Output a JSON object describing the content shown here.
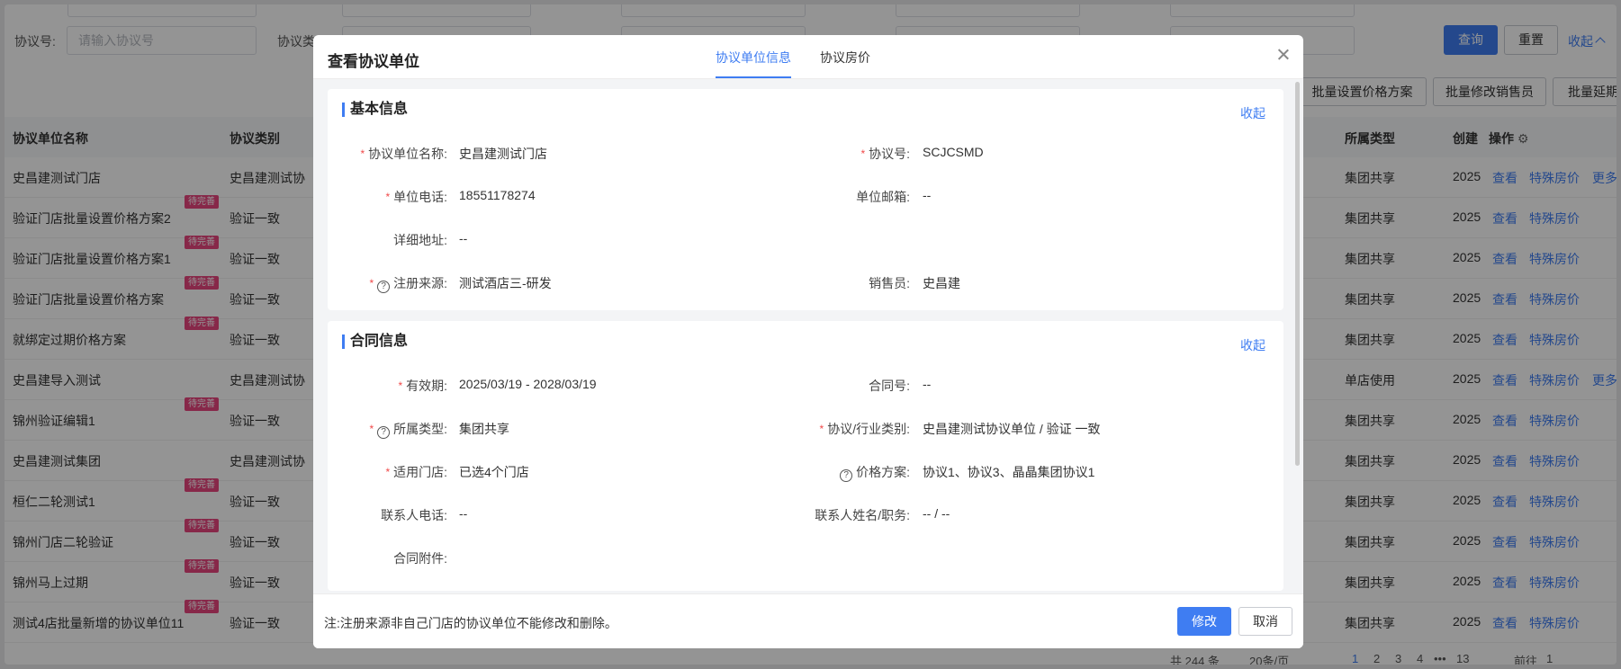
{
  "filters": {
    "agreement_no_label": "协议号:",
    "agreement_no_placeholder": "请输入协议号",
    "category_label": "协议类",
    "query_label": "查询",
    "reset_label": "重置",
    "collapse_label": "收起"
  },
  "batch_actions": [
    "批量设置价格方案",
    "批量修改销售员",
    "批量延期"
  ],
  "table": {
    "headers": {
      "name": "协议单位名称",
      "category": "协议类别",
      "type": "所属类型",
      "created": "创建",
      "actions": "操作"
    },
    "pending_tag": "待完善",
    "ops": {
      "view": "查看",
      "special": "特殊房价",
      "more": "更多"
    },
    "rows": [
      {
        "name": "史昌建测试门店",
        "category": "史昌建测试协",
        "type": "集团共享",
        "created": "2025",
        "tag": false,
        "more": true
      },
      {
        "name": "验证门店批量设置价格方案2",
        "category": "验证一致",
        "type": "集团共享",
        "created": "2025",
        "tag": true,
        "more": false
      },
      {
        "name": "验证门店批量设置价格方案1",
        "category": "验证一致",
        "type": "集团共享",
        "created": "2025",
        "tag": true,
        "more": false
      },
      {
        "name": "验证门店批量设置价格方案",
        "category": "验证一致",
        "type": "集团共享",
        "created": "2025",
        "tag": true,
        "more": false
      },
      {
        "name": "就绑定过期价格方案",
        "category": "验证一致",
        "type": "集团共享",
        "created": "2025",
        "tag": true,
        "more": false
      },
      {
        "name": "史昌建导入测试",
        "category": "史昌建测试协",
        "type": "单店使用",
        "created": "2025",
        "tag": false,
        "more": true
      },
      {
        "name": "锦州验证编辑1",
        "category": "验证一致",
        "type": "集团共享",
        "created": "2025",
        "tag": true,
        "more": false
      },
      {
        "name": "史昌建测试集团",
        "category": "史昌建测试协",
        "type": "集团共享",
        "created": "2025",
        "tag": false,
        "more": false
      },
      {
        "name": "桓仁二轮测试1",
        "category": "验证一致",
        "type": "集团共享",
        "created": "2025",
        "tag": true,
        "more": false
      },
      {
        "name": "锦州门店二轮验证",
        "category": "验证一致",
        "type": "集团共享",
        "created": "2025",
        "tag": true,
        "more": false
      },
      {
        "name": "锦州马上过期",
        "category": "验证一致",
        "type": "集团共享",
        "created": "2025",
        "tag": true,
        "more": false
      },
      {
        "name": "测试4店批量新增的协议单位11",
        "category": "验证一致",
        "type": "集团共享",
        "created": "2025",
        "tag": true,
        "more": false
      }
    ]
  },
  "pagination": {
    "total": "共 244 条",
    "page_size": "20条/页",
    "pages": [
      "1",
      "2",
      "3",
      "4",
      "•••",
      "13"
    ],
    "goto_label": "前往",
    "goto_value": "1"
  },
  "modal": {
    "title": "查看协议单位",
    "tabs": [
      "协议单位信息",
      "协议房价"
    ],
    "basic": {
      "title": "基本信息",
      "collapse": "收起",
      "name_label": "协议单位名称:",
      "name_value": "史昌建测试门店",
      "no_label": "协议号:",
      "no_value": "SCJCSMD",
      "phone_label": "单位电话:",
      "phone_value": "18551178274",
      "email_label": "单位邮箱:",
      "email_value": "--",
      "address_label": "详细地址:",
      "address_value": "--",
      "source_label": "注册来源:",
      "source_value": "测试酒店三-研发",
      "sales_label": "销售员:",
      "sales_value": "史昌建"
    },
    "contract": {
      "title": "合同信息",
      "collapse": "收起",
      "validity_label": "有效期:",
      "validity_value": "2025/03/19 - 2028/03/19",
      "contract_no_label": "合同号:",
      "contract_no_value": "--",
      "type_label": "所属类型:",
      "type_value": "集团共享",
      "industry_label": "协议/行业类别:",
      "industry_value": "史昌建测试协议单位 / 验证 一致",
      "stores_label": "适用门店:",
      "stores_value": "已选4个门店",
      "price_label": "价格方案:",
      "price_value": "协议1、协议3、晶晶集团协议1",
      "contact_phone_label": "联系人电话:",
      "contact_phone_value": "--",
      "contact_name_label": "联系人姓名/职务:",
      "contact_name_value": "-- / --",
      "attachment_label": "合同附件:"
    },
    "footer_note": "注:注册来源非自己门店的协议单位不能修改和删除。",
    "edit_label": "修改",
    "cancel_label": "取消"
  },
  "colors": {
    "primary": "#3f7df2",
    "tag": "#e8457f",
    "required": "#f04848"
  }
}
